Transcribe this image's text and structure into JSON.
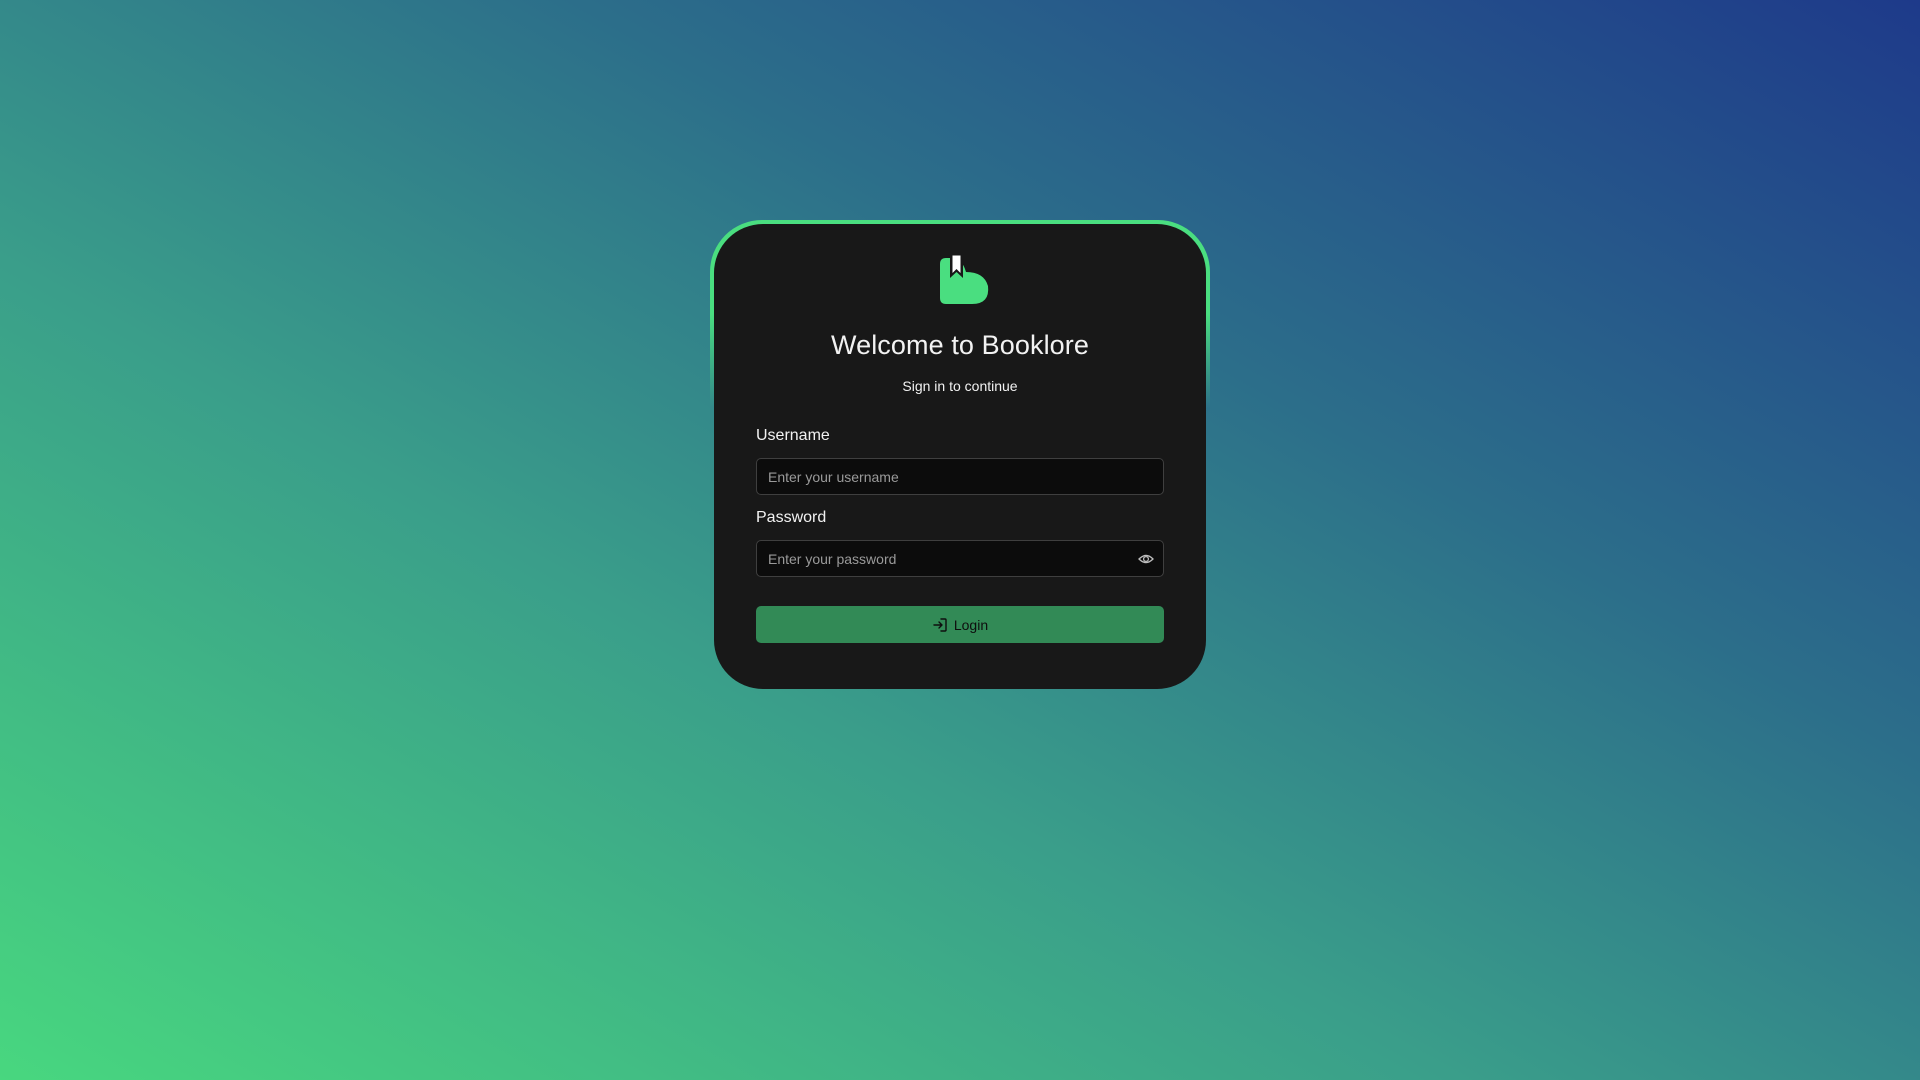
{
  "app": {
    "logo_icon": "booklore-logo-icon",
    "accent_color": "#4ade80",
    "button_color": "#328a56"
  },
  "login": {
    "title": "Welcome to Booklore",
    "subtitle": "Sign in to continue",
    "username": {
      "label": "Username",
      "placeholder": "Enter your username",
      "value": ""
    },
    "password": {
      "label": "Password",
      "placeholder": "Enter your password",
      "value": "",
      "toggle_icon": "eye-icon"
    },
    "submit": {
      "label": "Login",
      "icon": "sign-in-icon"
    }
  }
}
